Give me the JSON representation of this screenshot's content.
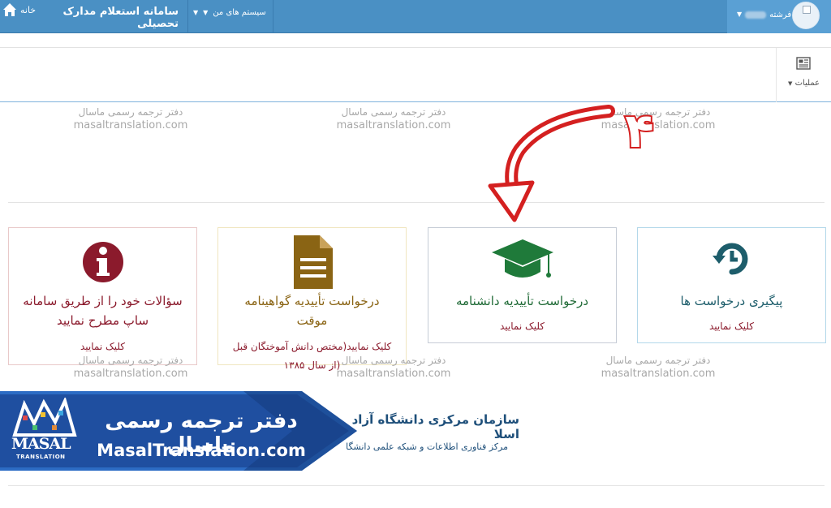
{
  "topbar": {
    "home_label": "خانه",
    "system_title": "سامانه استعلام مدارک تحصیلی",
    "my_systems": "سیستم های من",
    "user_name": "فرشته"
  },
  "toolbar": {
    "operations_label": "عملیات"
  },
  "watermark": {
    "fa": "دفتر ترجمه رسمی ماسال",
    "en": "masaltranslation.com"
  },
  "cards": {
    "track": {
      "title": "پیگیری درخواست ها",
      "cta": "کلیک نمایید"
    },
    "degree": {
      "title": "درخواست تأییدیه دانشنامه",
      "cta": "کلیک نمایید"
    },
    "cert": {
      "title_line1": "درخواست تأییدیه گواهینامه",
      "title_line2": "موقت",
      "cta_line1": "کلیک نمایید(مختص دانش آموختگان قبل",
      "cta_line2": "از سال ۱۳۸۵)"
    },
    "questions": {
      "title_line1": "سؤالات خود را از طریق سامانه",
      "title_line2": "ساپ مطرح نمایید",
      "cta": "کلیک نمایید"
    }
  },
  "footer": {
    "org_name": "سازمان مرکزی دانشگاه آزاد اسلا",
    "org_sub": "مرکز فناوری اطلاعات و شبکه علمی دانشگا"
  },
  "banner": {
    "fa": "دفتر ترجمه رسمی ماسال",
    "en": "MasalTranslation.com",
    "logo_text": "MASAL",
    "logo_sub": "TRANSLATION"
  },
  "annotation": {
    "arrow_number": "۴"
  },
  "colors": {
    "topbar": "#4a90c4",
    "cta": "#8b1a2c",
    "track_icon": "#1d5d6b",
    "degree_icon": "#1f7a3a",
    "cert_icon": "#8a6414",
    "questions_icon": "#8b1a2c",
    "banner": "#1f4fa0",
    "arrow": "#d42020"
  }
}
